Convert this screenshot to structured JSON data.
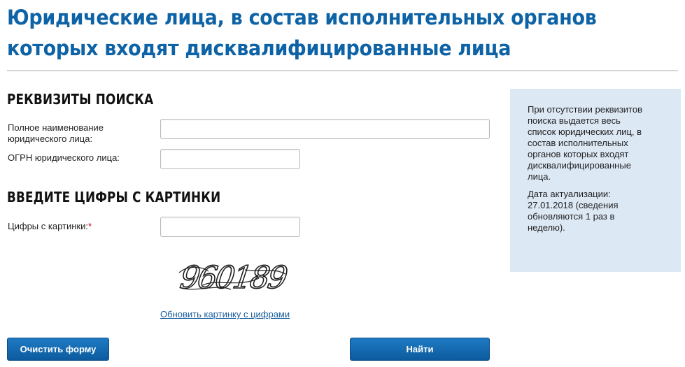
{
  "page": {
    "title": "Юридические лица, в состав исполнительных органов которых входят дисквалифицированные лица"
  },
  "search_section": {
    "heading": "РЕКВИЗИТЫ ПОИСКА",
    "full_name_label": "Полное наименование юридического лица:",
    "full_name_value": "",
    "ogrn_label": "ОГРН юридического лица:",
    "ogrn_value": ""
  },
  "captcha_section": {
    "heading": "ВВЕДИТЕ ЦИФРЫ С КАРТИНКИ",
    "digits_label": "Цифры с картинки:",
    "required_mark": "*",
    "digits_value": "",
    "captcha_text": "960189",
    "refresh_link": "Обновить картинку с цифрами"
  },
  "buttons": {
    "clear_label": "Очистить форму",
    "search_label": "Найти"
  },
  "info_panel": {
    "paragraph1": "При отсутствии реквизитов поиска выдается весь список юридических лиц, в состав исполнительных органов которых входят дисквалифицированные лица.",
    "paragraph2": "Дата актуализации: 27.01.2018 (сведения обновляются 1 раз в неделю)."
  },
  "colors": {
    "title": "#0d63a5",
    "panel_background": "#dde8f5",
    "button": "#1167ad",
    "link": "#1a5d9e",
    "required": "#d0021b"
  }
}
